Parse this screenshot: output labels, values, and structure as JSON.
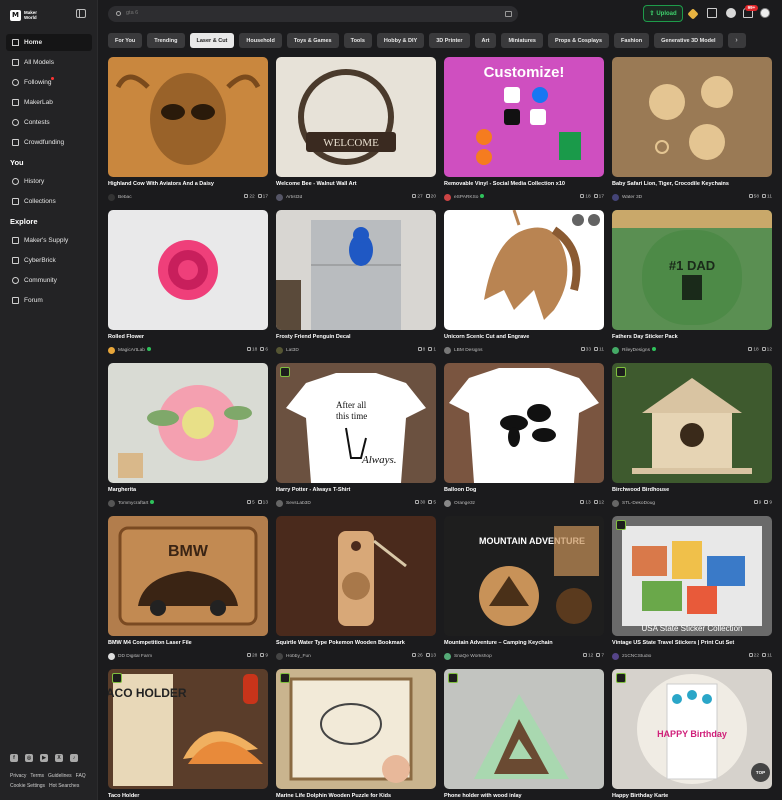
{
  "brand": {
    "line1": "Maker",
    "line2": "World"
  },
  "search": {
    "placeholder": "gta 6"
  },
  "header": {
    "upload_label": "Upload",
    "notif_badge": "99+"
  },
  "sidebar": {
    "main": [
      {
        "label": "Home",
        "active": true
      },
      {
        "label": "All Models"
      },
      {
        "label": "Following"
      },
      {
        "label": "MakerLab"
      },
      {
        "label": "Contests"
      },
      {
        "label": "Crowdfunding"
      }
    ],
    "you_heading": "You",
    "you": [
      {
        "label": "History"
      },
      {
        "label": "Collections"
      }
    ],
    "explore_heading": "Explore",
    "explore": [
      {
        "label": "Maker's Supply"
      },
      {
        "label": "CyberBrick"
      },
      {
        "label": "Community"
      },
      {
        "label": "Forum"
      }
    ],
    "footer_links": [
      "Privacy",
      "Terms",
      "Guidelines",
      "FAQ",
      "Cookie Settings",
      "Hot Searches"
    ]
  },
  "categories": [
    "For You",
    "Trending",
    "Laser & Cut",
    "Household",
    "Toys & Games",
    "Tools",
    "Hobby & DIY",
    "3D Printer",
    "Art",
    "Miniatures",
    "Props & Cosplays",
    "Fashion",
    "Generative 3D Model"
  ],
  "active_category": "Laser & Cut",
  "scroll_top_label": "TOP",
  "cards": [
    {
      "title": "Highland Cow With Aviators And a Daisy",
      "author": "Bebac",
      "likes": "22",
      "saves": "17",
      "bg": "#c9873e",
      "fg": "#7a4a1c",
      "avatar": "#333"
    },
    {
      "title": "Welcome Bee - Walnut Wall Art",
      "author": "Artist3d",
      "likes": "27",
      "saves": "20",
      "bg": "#e7e2d8",
      "fg": "#4a3a2c",
      "avatar": "#556"
    },
    {
      "title": "Removable Vinyl - Social Media Collection x10",
      "author": "eSPARKSo",
      "likes": "18",
      "saves": "17",
      "bg": "#cf4fc0",
      "fg": "#6ad0f0",
      "avatar": "#c44",
      "verified": true
    },
    {
      "title": "Baby Safari Lion, Tiger, Crocodile Keychains",
      "author": "Water 3D",
      "likes": "58",
      "saves": "11",
      "bg": "#9a7a55",
      "fg": "#e4c592",
      "avatar": "#447"
    },
    {
      "title": "Rolled Flower",
      "author": "MagicArtLab",
      "likes": "18",
      "saves": "6",
      "bg": "#e9e9ea",
      "fg": "#ef3f7a",
      "avatar": "#e8a63a",
      "verified": true
    },
    {
      "title": "Frosty Friend Penguin Decal",
      "author": "Lat3D",
      "likes": "8",
      "saves": "1",
      "bg": "#d8d6d2",
      "fg": "#1f58c4",
      "avatar": "#553"
    },
    {
      "title": "Unicorn Scenic Cut and Engrave",
      "author": "LBM Designs",
      "likes": "33",
      "saves": "11",
      "bg": "#ffffff",
      "fg": "#b98452",
      "avatar": "#777"
    },
    {
      "title": "Fathers Day Sticker Pack",
      "author": "RileyDesigns",
      "likes": "18",
      "saves": "12",
      "bg": "#5a8f52",
      "fg": "#1a2a1a",
      "avatar": "#4a6",
      "verified": true
    },
    {
      "title": "Margherita",
      "author": "Tommycraftart",
      "likes": "5",
      "saves": "13",
      "bg": "#d9dbd4",
      "fg": "#f4a0b0",
      "avatar": "#555",
      "verified": true
    },
    {
      "title": "Harry Potter - Always T-Shirt",
      "author": "SevsLab3D",
      "likes": "30",
      "saves": "5",
      "bg": "#6b5140",
      "fg": "#ffffff",
      "avatar": "#666"
    },
    {
      "title": "Balloon Dog",
      "author": "Orange3z",
      "likes": "13",
      "saves": "12",
      "bg": "#7a5540",
      "fg": "#ffffff",
      "avatar": "#888"
    },
    {
      "title": "Birchwood Birdhouse",
      "author": "STL-DekoDoug",
      "likes": "9",
      "saves": "9",
      "bg": "#3e5a2e",
      "fg": "#d9c4a2",
      "avatar": "#666"
    },
    {
      "title": "BMW M4 Competition Laser File",
      "author": "DD Digital Farm",
      "likes": "28",
      "saves": "9",
      "bg": "#b27d4c",
      "fg": "#3a2414",
      "avatar": "#ddd"
    },
    {
      "title": "Squirtle Water Type Pokemon Wooden Bookmark",
      "author": "Hobby_Fun",
      "likes": "26",
      "saves": "13",
      "bg": "#4a2a1c",
      "fg": "#d8a878",
      "avatar": "#444"
    },
    {
      "title": "Mountain Adventure – Camping Keychain",
      "author": "SnaQe Workshop",
      "likes": "12",
      "saves": "7",
      "bg": "#1e1e1e",
      "fg": "#c89258",
      "avatar": "#5a7"
    },
    {
      "title": "Vintage US State Travel Stickers | Print Cut Set",
      "author": "21CNCStudio",
      "likes": "22",
      "saves": "11",
      "bg": "#6a6a6a",
      "fg": "#e8a25a",
      "avatar": "#548"
    },
    {
      "title": "Taco Holder",
      "author": "",
      "likes": "",
      "saves": "",
      "bg": "#5a3d2a",
      "fg": "#f2d29a",
      "avatar": "#666"
    },
    {
      "title": "Marine Life Dolphin Wooden Puzzle for Kids",
      "author": "",
      "likes": "",
      "saves": "",
      "bg": "#c9b48e",
      "fg": "#8a6a42",
      "avatar": "#666"
    },
    {
      "title": "Phone holder with wood inlay",
      "author": "",
      "likes": "",
      "saves": "",
      "bg": "#c2c4c0",
      "fg": "#9ac8a0",
      "avatar": "#666"
    },
    {
      "title": "Happy Birthday Karte",
      "author": "",
      "likes": "",
      "saves": "",
      "bg": "#d6d2cc",
      "fg": "#2aa6c8",
      "avatar": "#666"
    }
  ],
  "thumb_text": {
    "welcome": "WELCOME",
    "customize": "Customize!",
    "dad": "#1 DAD",
    "always_1": "After all",
    "always_2": "this time",
    "always_3": "Always.",
    "bmw": "BMW",
    "mountain": "MOUNTAIN ADVENTURE",
    "usa": "USA State Sticker Collection",
    "taco": "TACO HOLDER",
    "happy": "HAPPY Birthday"
  }
}
